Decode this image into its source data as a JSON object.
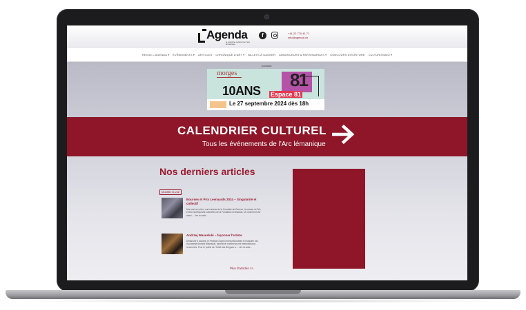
{
  "header": {
    "logo_text": "Agenda",
    "logo_sub": "le webzine culturel de l'arc lémanique",
    "facebook_icon": "f",
    "contact_phone": "+41 22 770 41 71",
    "contact_email": "info@agenda.ch"
  },
  "nav": {
    "items": [
      "REVUE L'AGENDA ▾",
      "ÉVÉNEMENTS ▾",
      "ARTICLES",
      "CHRONIQUE D'ART ▾",
      "BILLETS À GAGNER",
      "ANNONCEURS & PARTENARIATS ▾",
      "CONCOURS D'ÉCRITURE",
      "CULTURISSIMO ▾"
    ]
  },
  "ad": {
    "label": "publicité",
    "brand": "morges",
    "years": "10ANS",
    "venue": "Espace 81",
    "date": "Le 27 septembre 2024 dès 18h",
    "numeral": "81"
  },
  "calendar": {
    "title": "CALENDRIER CULTUREL",
    "subtitle": "Tous les événements de l'Arc lémanique"
  },
  "articles": {
    "section_title": "Nos derniers articles",
    "edit_label": "Modifier la vue",
    "items": [
      {
        "title": "Bourses et Prix Leenaards 2024 – Singularité et collectif",
        "text": "Mon sort a eu lieu, sur la scène de la Comédie de Genève, la remise du Prix et des huit Bourses culturelles de la Fondation Leenaards. Un moment riche aussi ... Lire la suite..."
      },
      {
        "title": "Andrzej Wasesluki – façonner l'artiste",
        "text": "Dimanche 6 octobre, le Festival Chopin recevra Bruxelles le musicien lors du pianiste Andrzej Wasesluki, lauréat de nombreux prix internationaux renommés. Pour le public de l'Hôtel des Bergues à ... Lire la suite..."
      }
    ],
    "more_link": "Plus d'articles >>"
  },
  "colors": {
    "brand": "#8e1628",
    "laptop_frame": "#1c1c1e"
  }
}
